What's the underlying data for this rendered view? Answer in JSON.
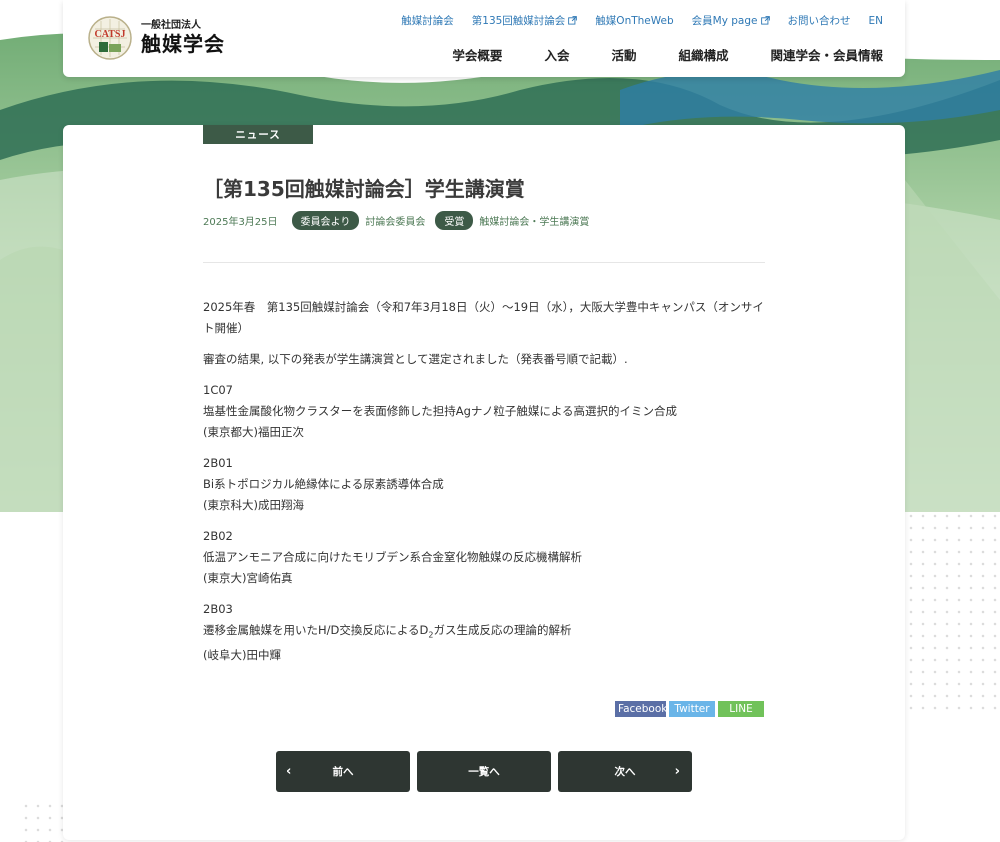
{
  "header": {
    "logo_sub": "一般社団法人",
    "logo_main": "触媒学会",
    "logo_mark_text": "CATSJ",
    "utility_nav": [
      {
        "label": "触媒討論会",
        "external": false
      },
      {
        "label": "第135回触媒討論会",
        "external": true
      },
      {
        "label": "触媒OnTheWeb",
        "external": false
      },
      {
        "label": "会員My page",
        "external": true
      },
      {
        "label": "お問い合わせ",
        "external": false
      },
      {
        "label": "EN",
        "external": false
      }
    ],
    "main_nav": [
      "学会概要",
      "入会",
      "活動",
      "組織構成",
      "関連学会・会員情報"
    ]
  },
  "article": {
    "category": "ニュース",
    "title": "［第135回触媒討論会］学生講演賞",
    "date": "2025年3月25日",
    "tags": [
      {
        "pill": "委員会より",
        "link": "討論会委員会"
      },
      {
        "pill": "受賞",
        "link": "触媒討論会・学生講演賞"
      }
    ],
    "intro": "2025年春　第135回触媒討論会（令和7年3月18日（火）〜19日（水），大阪大学豊中キャンパス（オンサイト開催）",
    "lead": "審査の結果, 以下の発表が学生講演賞として選定されました（発表番号順で記載）.",
    "entries": [
      {
        "code": "1C07",
        "title": "塩基性金属酸化物クラスターを表面修飾した担持Agナノ粒子触媒による高選択的イミン合成",
        "author": "(東京都大)福田正次"
      },
      {
        "code": "2B01",
        "title": "Bi系トポロジカル絶縁体による尿素誘導体合成",
        "author": "(東京科大)成田翔海"
      },
      {
        "code": "2B02",
        "title": "低温アンモニア合成に向けたモリブデン系合金窒化物触媒の反応機構解析",
        "author": "(東京大)宮崎佑真"
      },
      {
        "code": "2B03",
        "title_pre": "遷移金属触媒を用いたH/D交換反応によるD",
        "title_sub": "2",
        "title_post": "ガス生成反応の理論的解析",
        "author": "(岐阜大)田中輝"
      }
    ]
  },
  "share": {
    "facebook": "Facebook",
    "twitter": "Twitter",
    "line": "LINE"
  },
  "pager": {
    "prev": "前へ",
    "list": "一覧へ",
    "next": "次へ"
  },
  "colors": {
    "accent_green": "#3d5a47",
    "link_blue": "#2e78b5",
    "pager_bg": "#2e3632"
  }
}
